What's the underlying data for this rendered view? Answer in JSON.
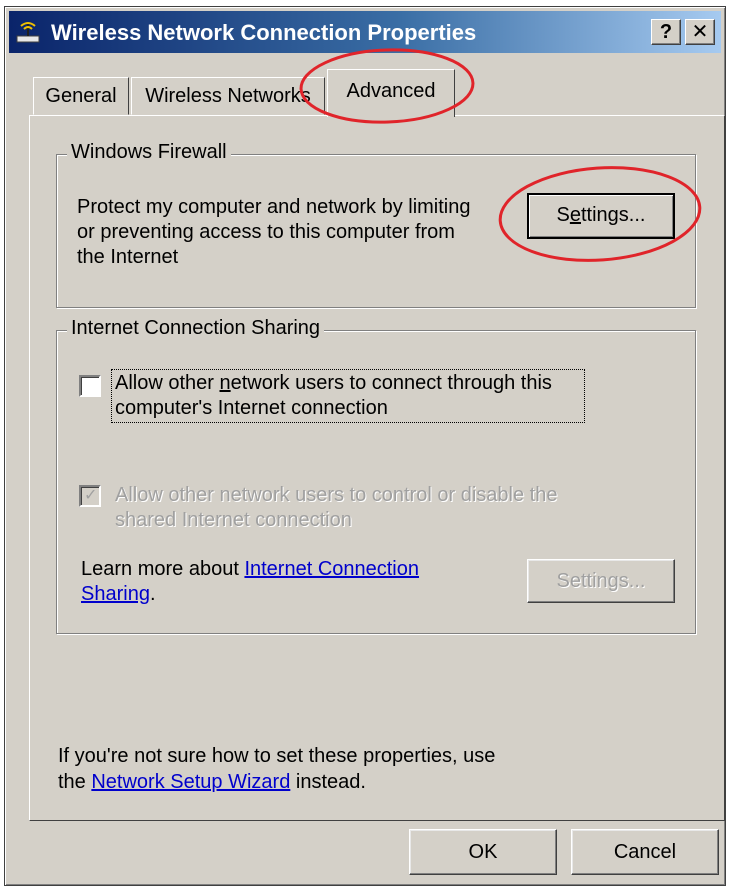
{
  "window": {
    "title": "Wireless Network Connection Properties",
    "help_button": "?",
    "close_button": "✕"
  },
  "tabs": [
    {
      "label": "General"
    },
    {
      "label": "Wireless Networks"
    },
    {
      "label": "Advanced",
      "active": true
    }
  ],
  "firewall": {
    "group_title": "Windows Firewall",
    "desc_line1": "Protect my computer and network by limiting",
    "desc_line2": "or preventing access to this computer from",
    "desc_line3": "the Internet",
    "settings_before": "S",
    "settings_underlined": "e",
    "settings_after": "ttings..."
  },
  "ics": {
    "group_title": "Internet Connection Sharing",
    "allow_connect_before": "Allow other ",
    "allow_connect_underlined": "n",
    "allow_connect_after": "etwork users to connect through this",
    "allow_connect_line2": "computer's Internet connection",
    "allow_connect_checked": false,
    "allow_control_line1": "Allow other network users to control or disable the",
    "allow_control_line2": "shared Internet connection",
    "allow_control_checked": true,
    "learn_more_prefix": "Learn more about ",
    "learn_more_link_line1": "Internet Connection",
    "learn_more_link_line2": "Sharing",
    "learn_more_suffix": ".",
    "settings_before": "Settin",
    "settings_underlined": "g",
    "settings_after": "s..."
  },
  "footer": {
    "line1": "If you're not sure how to set these properties, use",
    "line2_prefix": "the ",
    "wizard_link": "Network Setup Wizard",
    "line2_suffix": " instead."
  },
  "buttons": {
    "ok": "OK",
    "cancel": "Cancel"
  },
  "colors": {
    "dialog_bg": "#d4d0c8",
    "title_gradient_start": "#0a246a",
    "title_gradient_end": "#a6caf0",
    "link": "#0000cc",
    "annotation_circle": "#e0242a"
  }
}
